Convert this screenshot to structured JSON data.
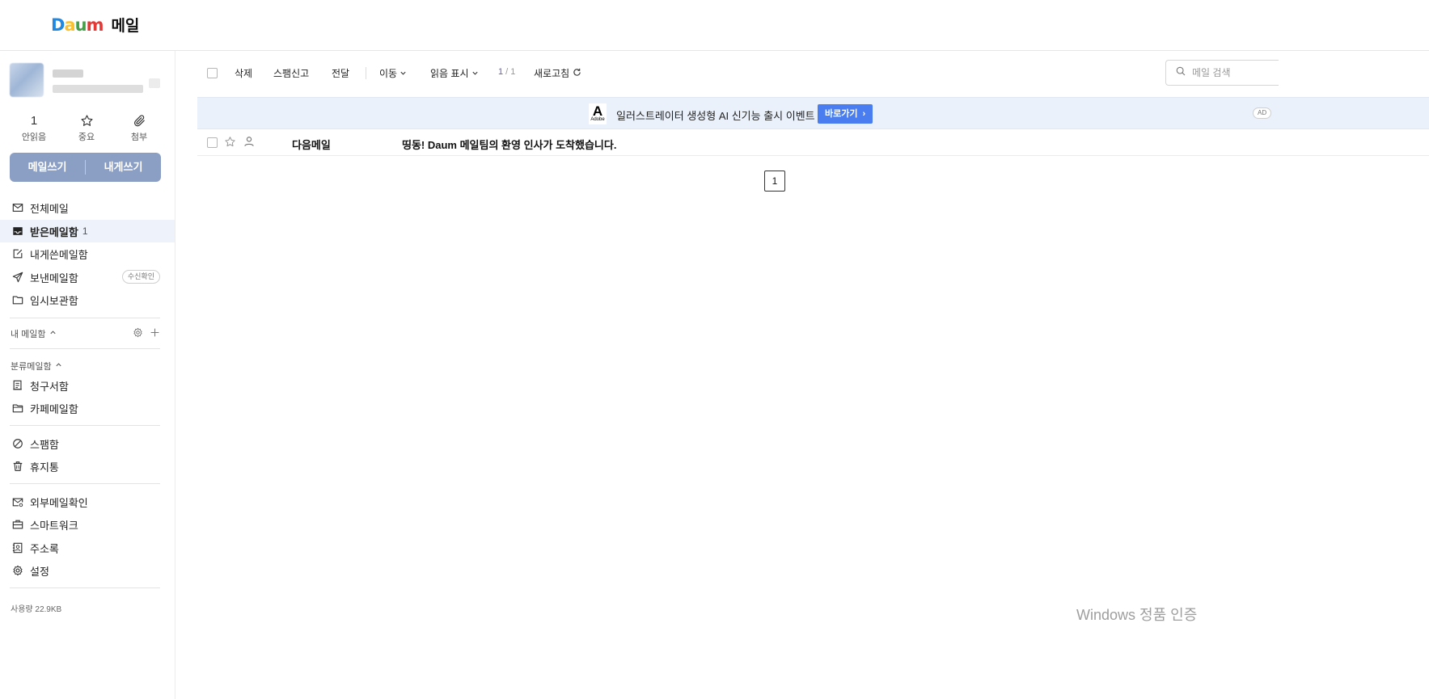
{
  "header": {
    "logo_text": "Daum",
    "app_title": "메일"
  },
  "sidebar": {
    "quick": [
      {
        "value": "1",
        "label": "안읽음"
      },
      {
        "label": "중요",
        "icon": "star-icon"
      },
      {
        "label": "첨부",
        "icon": "paperclip-icon"
      }
    ],
    "compose": {
      "write": "메일쓰기",
      "write_self": "내게쓰기"
    },
    "mailboxes": [
      {
        "label": "전체메일",
        "icon": "envelope-icon"
      },
      {
        "label": "받은메일함",
        "count": "1",
        "icon": "inbox-icon",
        "active": true
      },
      {
        "label": "내게쓴메일함",
        "icon": "note-edit-icon"
      },
      {
        "label": "보낸메일함",
        "icon": "send-icon",
        "badge": "수신확인"
      },
      {
        "label": "임시보관함",
        "icon": "folder-icon"
      }
    ],
    "my_mailbox_label": "내 메일함",
    "category_label": "분류메일함",
    "category_items": [
      {
        "label": "청구서함",
        "icon": "receipt-icon"
      },
      {
        "label": "카페메일함",
        "icon": "folder-icon"
      }
    ],
    "system_items": [
      {
        "label": "스팸함",
        "icon": "ban-icon"
      },
      {
        "label": "휴지통",
        "icon": "trash-icon"
      }
    ],
    "tool_items": [
      {
        "label": "외부메일확인",
        "icon": "external-mail-icon"
      },
      {
        "label": "스마트워크",
        "icon": "briefcase-icon"
      },
      {
        "label": "주소록",
        "icon": "contact-book-icon"
      },
      {
        "label": "설정",
        "icon": "gear-icon"
      }
    ],
    "usage": "사용량 22.9KB"
  },
  "toolbar": {
    "delete": "삭제",
    "spam_report": "스팸신고",
    "forward": "전달",
    "move": "이동",
    "mark_read": "읽음 표시",
    "page_current": "1",
    "page_sep": " / ",
    "page_total": "1",
    "refresh": "새로고침",
    "search_placeholder": "메일 검색"
  },
  "ad": {
    "logo_letter": "A",
    "logo_text": "Adobe",
    "text": "일러스트레이터 생성형 AI 신기능 출시 이벤트",
    "button": "바로가기",
    "tag": "AD"
  },
  "mail_list": [
    {
      "sender": "다음메일",
      "subject": "띵동! Daum 메일팀의 환영 인사가 도착했습니다."
    }
  ],
  "pagination": {
    "current": "1"
  },
  "watermark": "Windows 정품 인증",
  "colors": {
    "accent": "#8b9fc4",
    "ad_button": "#4a7df0",
    "active_bg": "#eef3fb"
  }
}
